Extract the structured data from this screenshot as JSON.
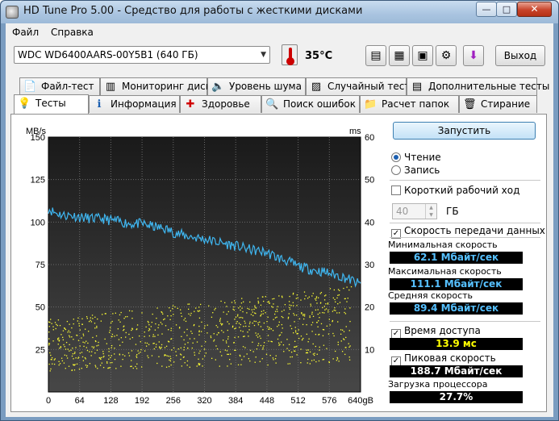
{
  "window": {
    "title": "HD Tune Pro 5.00 - Средство для работы с жесткими дисками",
    "btn_minimize": "—",
    "btn_maximize": "□",
    "btn_close": "✕"
  },
  "menu": {
    "file": "Файл",
    "help": "Справка"
  },
  "toolbar": {
    "drive": "WDC WD6400AARS-00Y5B1 (640 ГБ)",
    "temperature": "35°C",
    "exit": "Выход",
    "icons": [
      "copy-icon",
      "copy-all-icon",
      "save-icon",
      "options-icon",
      "download-icon"
    ]
  },
  "tabs_row1": [
    {
      "label": "Файл-тест",
      "icon": "file-test-icon"
    },
    {
      "label": "Мониторинг диска",
      "icon": "monitor-icon"
    },
    {
      "label": "Уровень шума",
      "icon": "speaker-icon"
    },
    {
      "label": "Случайный тест",
      "icon": "random-icon"
    },
    {
      "label": "Дополнительные тесты",
      "icon": "extra-tests-icon"
    }
  ],
  "tabs_row2": [
    {
      "label": "Тесты",
      "icon": "bulb-icon",
      "active": true
    },
    {
      "label": "Информация",
      "icon": "info-icon"
    },
    {
      "label": "Здоровье",
      "icon": "health-icon"
    },
    {
      "label": "Поиск ошибок",
      "icon": "magnifier-icon"
    },
    {
      "label": "Расчет папок",
      "icon": "folder-icon"
    },
    {
      "label": "Стирание",
      "icon": "trash-icon"
    }
  ],
  "controls": {
    "start": "Запустить",
    "read": "Чтение",
    "write": "Запись",
    "short_stroke": "Короткий рабочий ход",
    "short_value": "40",
    "gb": "ГБ",
    "transfer_rate": "Скорость передачи данных",
    "access_time": "Время доступа",
    "burst_rate": "Пиковая скорость",
    "cpu_usage": "Загрузка процессора"
  },
  "stats": {
    "min_label": "Минимальная скорость",
    "min_value": "62.1 Мбайт/сек",
    "max_label": "Максимальная скорость",
    "max_value": "111.1 Мбайт/сек",
    "avg_label": "Средняя скорость",
    "avg_value": "89.4 Мбайт/сек",
    "access_value": "13.9 мс",
    "burst_value": "188.7 Мбайт/сек",
    "cpu_value": "27.7%"
  },
  "chart_data": {
    "type": "line",
    "left_unit": "MB/s",
    "right_unit": "ms",
    "y_ticks": [
      "150",
      "125",
      "100",
      "75",
      "50",
      "25"
    ],
    "y_right_ticks": [
      "60",
      "50",
      "40",
      "30",
      "20",
      "10"
    ],
    "x_ticks": [
      "0",
      "64",
      "128",
      "192",
      "256",
      "320",
      "384",
      "448",
      "512",
      "576",
      "640gB"
    ],
    "xlim": [
      0,
      640
    ],
    "ylim": [
      0,
      150
    ],
    "ylim_right": [
      0,
      60
    ],
    "series": [
      {
        "name": "transfer",
        "color": "#3fb6f0",
        "x": [
          0,
          10,
          20,
          32,
          45,
          64,
          90,
          110,
          128,
          150,
          170,
          192,
          220,
          240,
          256,
          280,
          300,
          320,
          350,
          384,
          410,
          448,
          470,
          490,
          512,
          540,
          576,
          600,
          620,
          640
        ],
        "values": [
          108,
          106,
          105,
          104,
          104,
          103,
          102,
          102,
          101,
          100,
          99,
          99,
          97,
          96,
          94,
          92,
          91,
          90,
          88,
          86,
          84,
          82,
          79,
          77,
          74,
          72,
          70,
          68,
          66,
          63
        ]
      }
    ],
    "access_points": {
      "name": "access time",
      "color": "#ffff33",
      "x_range": [
        0,
        620
      ],
      "ms_min": 5,
      "ms_max": 23
    }
  }
}
